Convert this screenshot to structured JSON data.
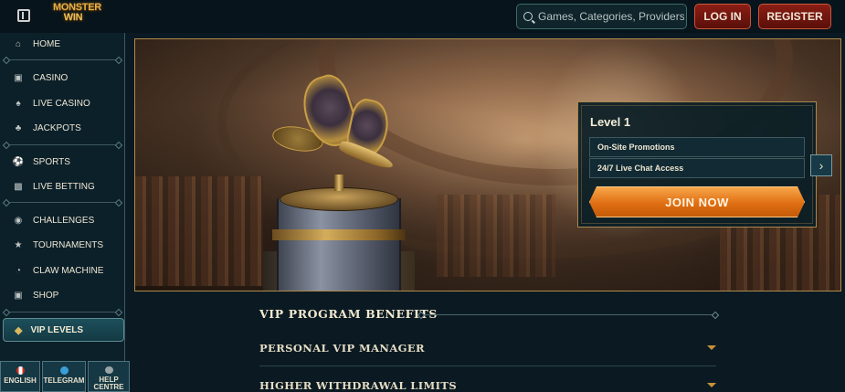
{
  "header": {
    "logo_line1": "MONSTER",
    "logo_line2": "WIN",
    "search_placeholder": "Games, Categories, Providers",
    "login_label": "LOG IN",
    "register_label": "REGISTER"
  },
  "sidebar": {
    "items": [
      {
        "label": "HOME",
        "icon": "home-icon"
      },
      {
        "label": "CASINO",
        "icon": "slot-machine-icon"
      },
      {
        "label": "LIVE CASINO",
        "icon": "cards-icon"
      },
      {
        "label": "JACKPOTS",
        "icon": "clover-icon"
      },
      {
        "label": "SPORTS",
        "icon": "ball-icon"
      },
      {
        "label": "LIVE BETTING",
        "icon": "live-icon"
      },
      {
        "label": "CHALLENGES",
        "icon": "medal-icon"
      },
      {
        "label": "TOURNAMENTS",
        "icon": "trophy-icon"
      },
      {
        "label": "CLAW MACHINE",
        "icon": "claw-icon"
      },
      {
        "label": "SHOP",
        "icon": "bag-icon"
      }
    ],
    "active_item": {
      "label": "VIP LEVELS",
      "icon": "diamond-icon"
    },
    "footer": [
      {
        "label": "ENGLISH",
        "icon": "canada-flag-icon"
      },
      {
        "label": "TELEGRAM",
        "icon": "telegram-icon"
      },
      {
        "label_1": "HELP",
        "label_2": "CENTRE",
        "icon": "help-icon"
      }
    ]
  },
  "level_card": {
    "title": "Level 1",
    "benefits": [
      "On-Site Promotions",
      "24/7 Live Chat Access"
    ],
    "join_label": "JOIN NOW"
  },
  "vip": {
    "section_title": "VIP PROGRAM BENEFITS",
    "accordion": [
      "PERSONAL VIP MANAGER",
      "HIGHER WITHDRAWAL LIMITS"
    ]
  },
  "colors": {
    "background": "#0b1a22",
    "accent_gold": "#c8913d",
    "button_red": "#8a1e14",
    "join_orange": "#e06e12",
    "active_teal": "#1c4f5c"
  }
}
